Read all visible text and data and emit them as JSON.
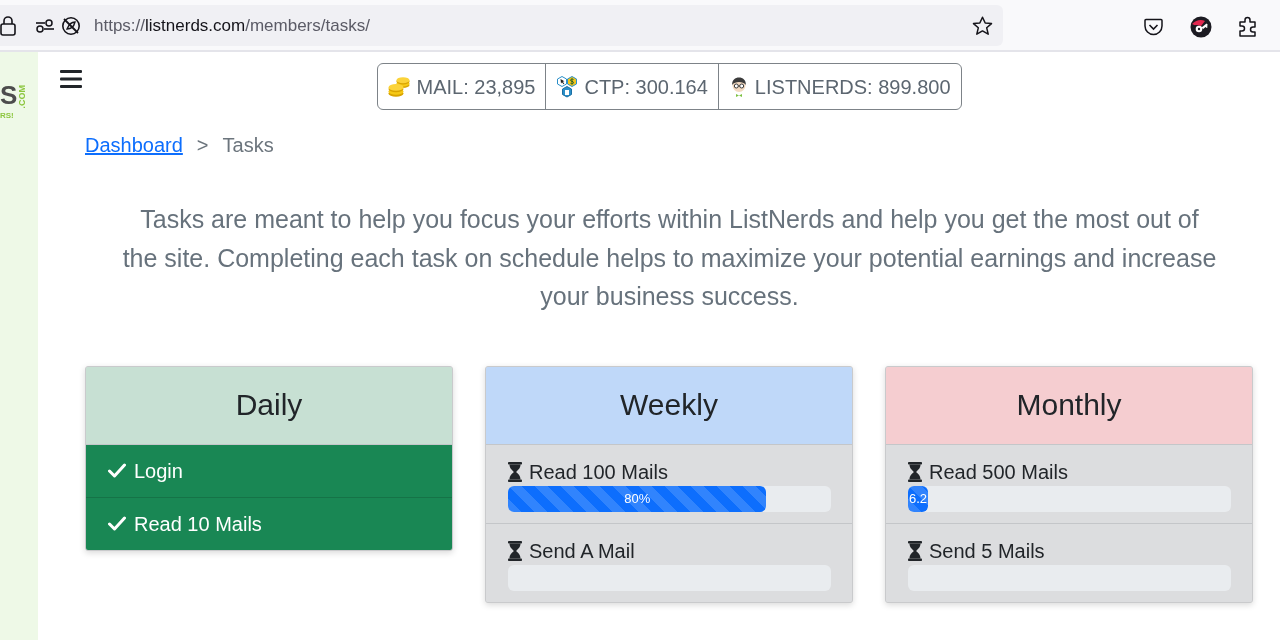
{
  "browser": {
    "url": {
      "scheme": "https://",
      "host": "listnerds.com",
      "path": "/members/tasks/"
    }
  },
  "logo": {
    "letter": "S",
    "domain": ".COM",
    "tagline": "RS!"
  },
  "balances": [
    {
      "kind": "coins",
      "label": "MAIL: 23,895"
    },
    {
      "kind": "hexagons",
      "label": "CTP: 300.164"
    },
    {
      "kind": "mascot",
      "label": "LISTNERDS: 899.800"
    }
  ],
  "breadcrumb": {
    "separator": ">",
    "items": [
      {
        "label": "Dashboard",
        "link": true
      },
      {
        "label": "Tasks",
        "link": false
      }
    ]
  },
  "intro": "Tasks are meant to help you focus your efforts within ListNerds and help you get the most out of the site. Completing each task on schedule helps to maximize your potential earnings and increase your business success.",
  "task_groups": [
    {
      "title": "Daily",
      "color": "#c7e0d3",
      "tasks": [
        {
          "label": "Login",
          "completed": true
        },
        {
          "label": "Read 10 Mails",
          "completed": true
        }
      ]
    },
    {
      "title": "Weekly",
      "color": "#bfd8f9",
      "tasks": [
        {
          "label": "Read 100 Mails",
          "completed": false,
          "level": 0.8,
          "reading": "80%"
        },
        {
          "label": "Send A Mail",
          "completed": false
        }
      ]
    },
    {
      "title": "Monthly",
      "color": "#f5cdd0",
      "tasks": [
        {
          "label": "Read 500 Mails",
          "completed": false,
          "level": 0.062,
          "reading": "6.2"
        },
        {
          "label": "Send 5 Mails",
          "completed": false
        }
      ]
    }
  ]
}
